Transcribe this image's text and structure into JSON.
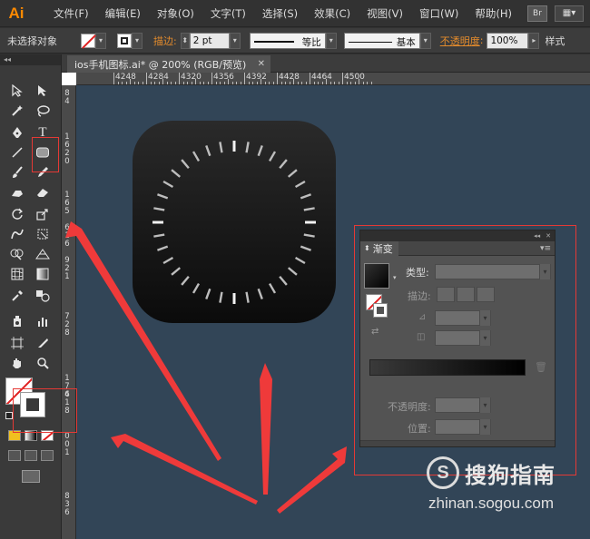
{
  "app": {
    "logo": "Ai"
  },
  "menu": {
    "items": [
      "文件(F)",
      "编辑(E)",
      "对象(O)",
      "文字(T)",
      "选择(S)",
      "效果(C)",
      "视图(V)",
      "窗口(W)",
      "帮助(H)"
    ],
    "bridge_label": "Br",
    "workspace_label": "▦▾"
  },
  "controlbar": {
    "selection_status": "未选择对象",
    "stroke_label": "描边:",
    "stroke_weight": "2 pt",
    "stroke_profile": "等比",
    "brush_definition": "基本",
    "opacity_label": "不透明度",
    "opacity_value": "100%",
    "style_label": "样式"
  },
  "document": {
    "tab_title": "ios手机图标.ai* @ 200% (RGB/预览)",
    "close_glyph": "✕"
  },
  "ruler": {
    "top_labels": [
      "4248",
      "4284",
      "4320",
      "4356",
      "4392",
      "4428",
      "4464",
      "4500"
    ],
    "left_digits": [
      "8",
      "4",
      "1",
      "6",
      "2",
      "0",
      "1",
      "6",
      "5",
      "6",
      "1",
      "6",
      "9",
      "2",
      "1",
      "7",
      "2",
      "8",
      "1",
      "7",
      "6",
      "4",
      "1",
      "8",
      "0",
      "0",
      "1",
      "8",
      "3",
      "6"
    ]
  },
  "gradient_panel": {
    "tab_label": "渐变",
    "type_label": "类型:",
    "stroke_label": "描边:",
    "opacity_label": "不透明度:",
    "location_label": "位置:",
    "collapse_glyph": "◂◂",
    "close_glyph": "✕",
    "menu_glyph": "▾≡"
  },
  "watermark": {
    "logo_letter": "S",
    "text": "搜狗指南",
    "url": "zhinan.sogou.com"
  },
  "colors": {
    "canvas": "#324557",
    "annotation_red": "#e53935",
    "ai_orange": "#ff8a00"
  }
}
